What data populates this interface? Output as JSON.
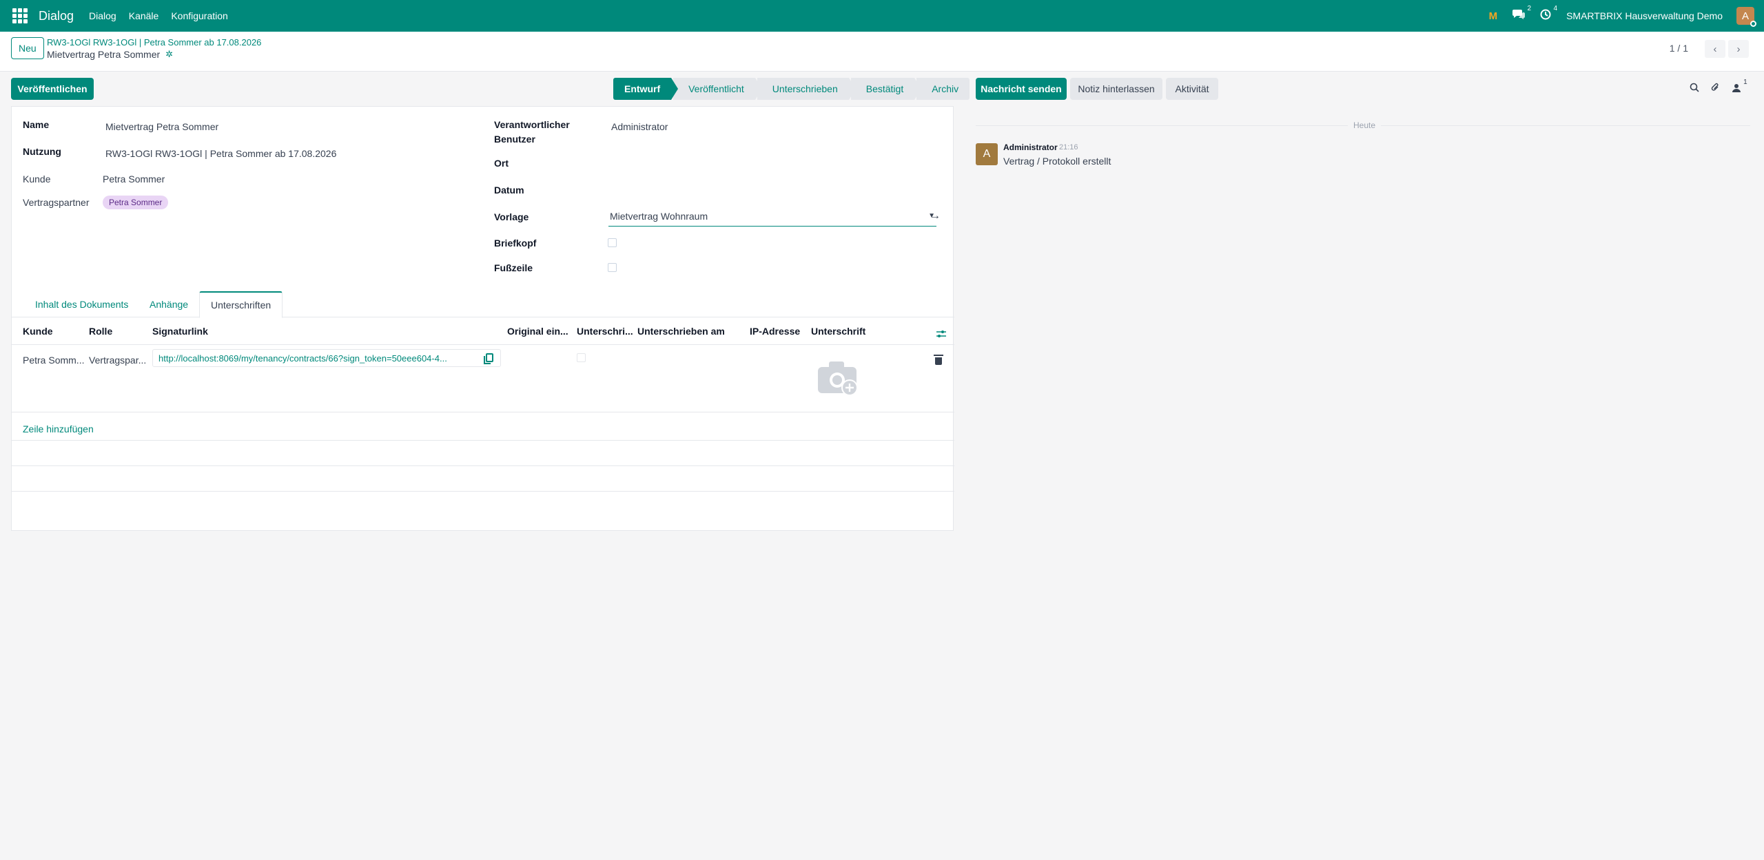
{
  "navbar": {
    "app_name": "Dialog",
    "menus": [
      "Dialog",
      "Kanäle",
      "Konfiguration"
    ],
    "messages_count": "2",
    "activities_count": "4",
    "company": "SMARTBRIX Hausverwaltung Demo",
    "avatar_letter": "A",
    "bg_color": "#00897b"
  },
  "control": {
    "new_label": "Neu",
    "breadcrumb": "RW3-1OGl RW3-1OGl | Petra Sommer ab 17.08.2026",
    "record_title": "Mietvertrag Petra Sommer",
    "pager": "1 / 1"
  },
  "actions": {
    "publish_label": "Veröffentlichen"
  },
  "statusbar": {
    "stages": [
      "Entwurf",
      "Veröffentlicht",
      "Unterschrieben",
      "Bestätigt",
      "Archiv"
    ],
    "active": "Entwurf"
  },
  "form": {
    "name_label": "Name",
    "name_value": "Mietvertrag Petra Sommer",
    "nutzung_label": "Nutzung",
    "nutzung_value": "RW3-1OGl RW3-1OGl | Petra Sommer ab 17.08.2026",
    "kunde_label": "Kunde",
    "kunde_value": "Petra Sommer",
    "partner_label": "Vertragspartner",
    "partner_tag": "Petra Sommer",
    "responsible_label_1": "Verantwortlicher",
    "responsible_label_2": "Benutzer",
    "responsible_value": "Administrator",
    "ort_label": "Ort",
    "datum_label": "Datum",
    "vorlage_label": "Vorlage",
    "vorlage_value": "Mietvertrag Wohnraum",
    "briefkopf_label": "Briefkopf",
    "fusszeile_label": "Fußzeile"
  },
  "tabs": [
    "Inhalt des Dokuments",
    "Anhänge",
    "Unterschriften"
  ],
  "table": {
    "headers": [
      "Kunde",
      "Rolle",
      "Signaturlink",
      "Original ein...",
      "Unterschri...",
      "Unterschrieben am",
      "IP-Adresse",
      "Unterschrift"
    ],
    "rows": [
      {
        "kunde": "Petra Somm...",
        "rolle": "Vertragspar...",
        "link": "http://localhost:8069/my/tenancy/contracts/66?sign_token=50eee604-4..."
      }
    ],
    "add_line": "Zeile hinzufügen"
  },
  "chatter": {
    "send_message": "Nachricht senden",
    "log_note": "Notiz hinterlassen",
    "activity": "Aktivität",
    "followers_count": "1",
    "today": "Heute",
    "message": {
      "avatar_letter": "A",
      "author": "Administrator",
      "time": "21:16",
      "body": "Vertrag / Protokoll erstellt"
    }
  }
}
